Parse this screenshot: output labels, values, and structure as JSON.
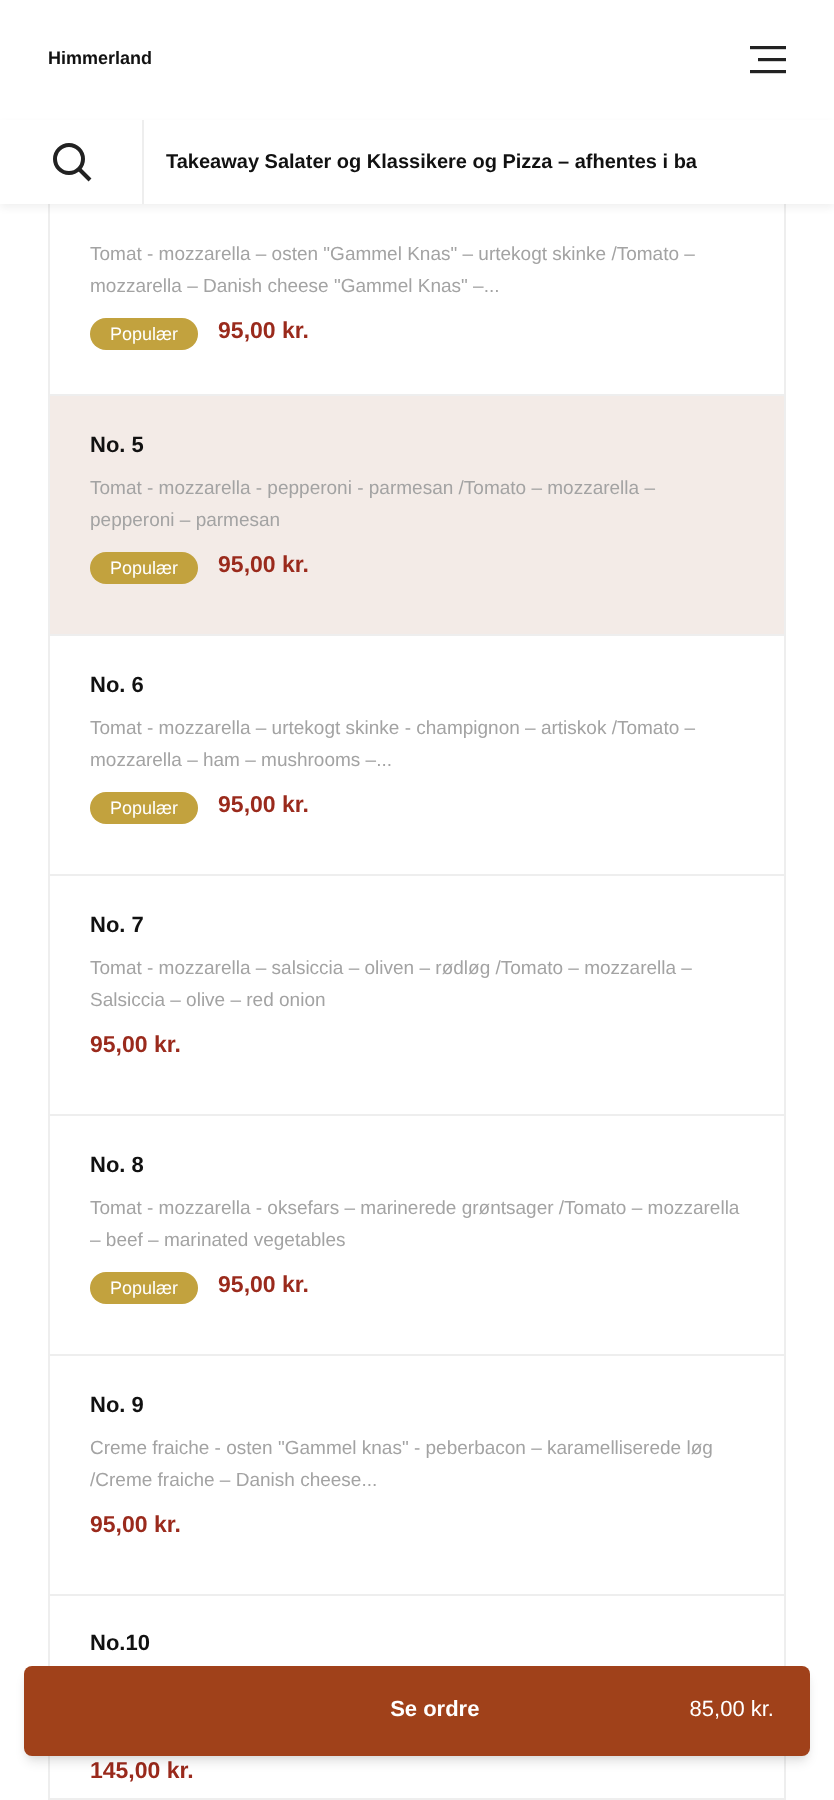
{
  "header": {
    "title": "Himmerland"
  },
  "category_bar": {
    "title": "Takeaway Salater og Klassikere og Pizza – afhentes i ba"
  },
  "items": [
    {
      "description": "Tomat - mozzarella – osten \"Gammel Knas\" – urtekogt skinke /Tomato – mozzarella – Danish cheese \"Gammel Knas\" –...",
      "badge": "Populær",
      "price": "95,00 kr.",
      "selected": false
    },
    {
      "title": "No. 5",
      "description": "Tomat - mozzarella - pepperoni - parmesan /Tomato – mozzarella – pepperoni – parmesan",
      "badge": "Populær",
      "price": "95,00 kr.",
      "selected": true
    },
    {
      "title": "No. 6",
      "description": "Tomat - mozzarella – urtekogt skinke - champignon – artiskok /Tomato – mozzarella – ham – mushrooms –...",
      "badge": "Populær",
      "price": "95,00 kr.",
      "selected": false
    },
    {
      "title": "No. 7",
      "description": "Tomat - mozzarella – salsiccia – oliven – rødløg /Tomato – mozzarella – Salsiccia – olive – red onion",
      "price": "95,00 kr.",
      "selected": false
    },
    {
      "title": "No. 8",
      "description": "Tomat - mozzarella - oksefars – marinerede grøntsager /Tomato – mozzarella – beef – marinated vegetables",
      "badge": "Populær",
      "price": "95,00 kr.",
      "selected": false
    },
    {
      "title": "No. 9",
      "description": "Creme fraiche - osten \"Gammel knas\" - peberbacon – karamelliserede løg /Creme fraiche – Danish cheese...",
      "price": "95,00 kr.",
      "selected": false
    },
    {
      "title": "No.10",
      "price": "145,00 kr.",
      "selected": false
    }
  ],
  "order_button": {
    "label": "Se ordre",
    "total": "85,00 kr."
  }
}
